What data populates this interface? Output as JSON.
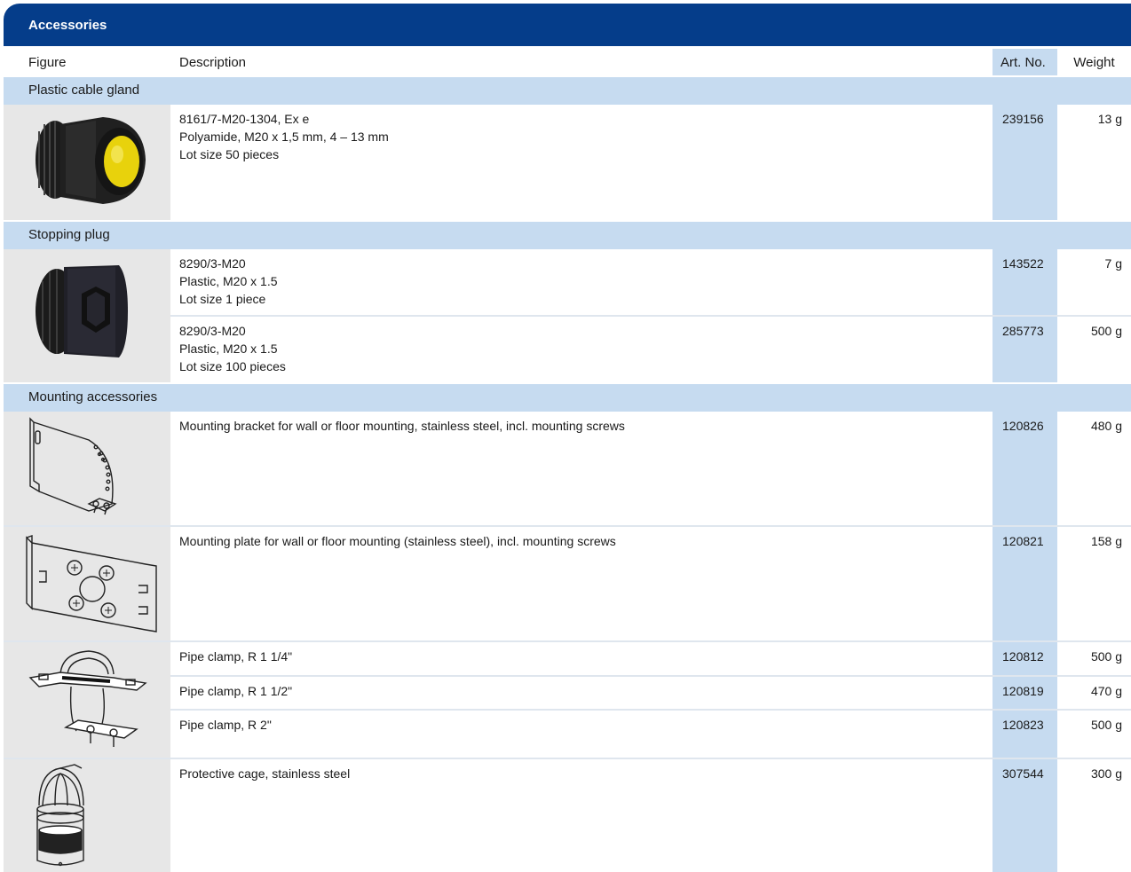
{
  "title": "Accessories",
  "columns": {
    "figure": "Figure",
    "description": "Description",
    "art_no": "Art. No.",
    "weight": "Weight"
  },
  "sections": [
    {
      "name": "Plastic cable gland",
      "rows": [
        {
          "desc": [
            "8161/7-M20-1304, Ex e",
            "Polyamide, M20 x 1,5 mm, 4 – 13 mm",
            "Lot size 50 pieces"
          ],
          "art": "239156",
          "weight": "13 g"
        }
      ]
    },
    {
      "name": "Stopping plug",
      "rows": [
        {
          "desc": [
            "8290/3-M20",
            "Plastic, M20 x 1.5",
            "Lot size 1 piece"
          ],
          "art": "143522",
          "weight": "7 g"
        },
        {
          "desc": [
            "8290/3-M20",
            "Plastic, M20 x 1.5",
            "Lot size 100 pieces"
          ],
          "art": "285773",
          "weight": "500 g"
        }
      ]
    },
    {
      "name": "Mounting accessories",
      "rows": [
        {
          "desc": [
            "Mounting bracket for wall or floor mounting, stainless steel, incl. mounting screws"
          ],
          "art": "120826",
          "weight": "480 g"
        },
        {
          "desc": [
            "Mounting plate for wall or floor mounting (stainless steel), incl. mounting screws"
          ],
          "art": "120821",
          "weight": "158 g"
        },
        {
          "desc": [
            "Pipe clamp, R 1 1/4\""
          ],
          "art": "120812",
          "weight": "500 g"
        },
        {
          "desc": [
            "Pipe clamp, R 1 1/2\""
          ],
          "art": "120819",
          "weight": "470 g"
        },
        {
          "desc": [
            "Pipe clamp, R 2\""
          ],
          "art": "120823",
          "weight": "500 g"
        },
        {
          "desc": [
            "Protective cage, stainless steel"
          ],
          "art": "307544",
          "weight": "300 g"
        }
      ]
    }
  ],
  "colors": {
    "title_bar": "#053d8a",
    "section_band": "#c6dbf0",
    "figure_bg": "#e7e7e7"
  },
  "figures": [
    "cable-gland-image",
    "stopping-plug-image",
    "mounting-bracket-drawing",
    "mounting-plate-drawing",
    "pipe-clamp-drawing",
    "protective-cage-drawing"
  ]
}
